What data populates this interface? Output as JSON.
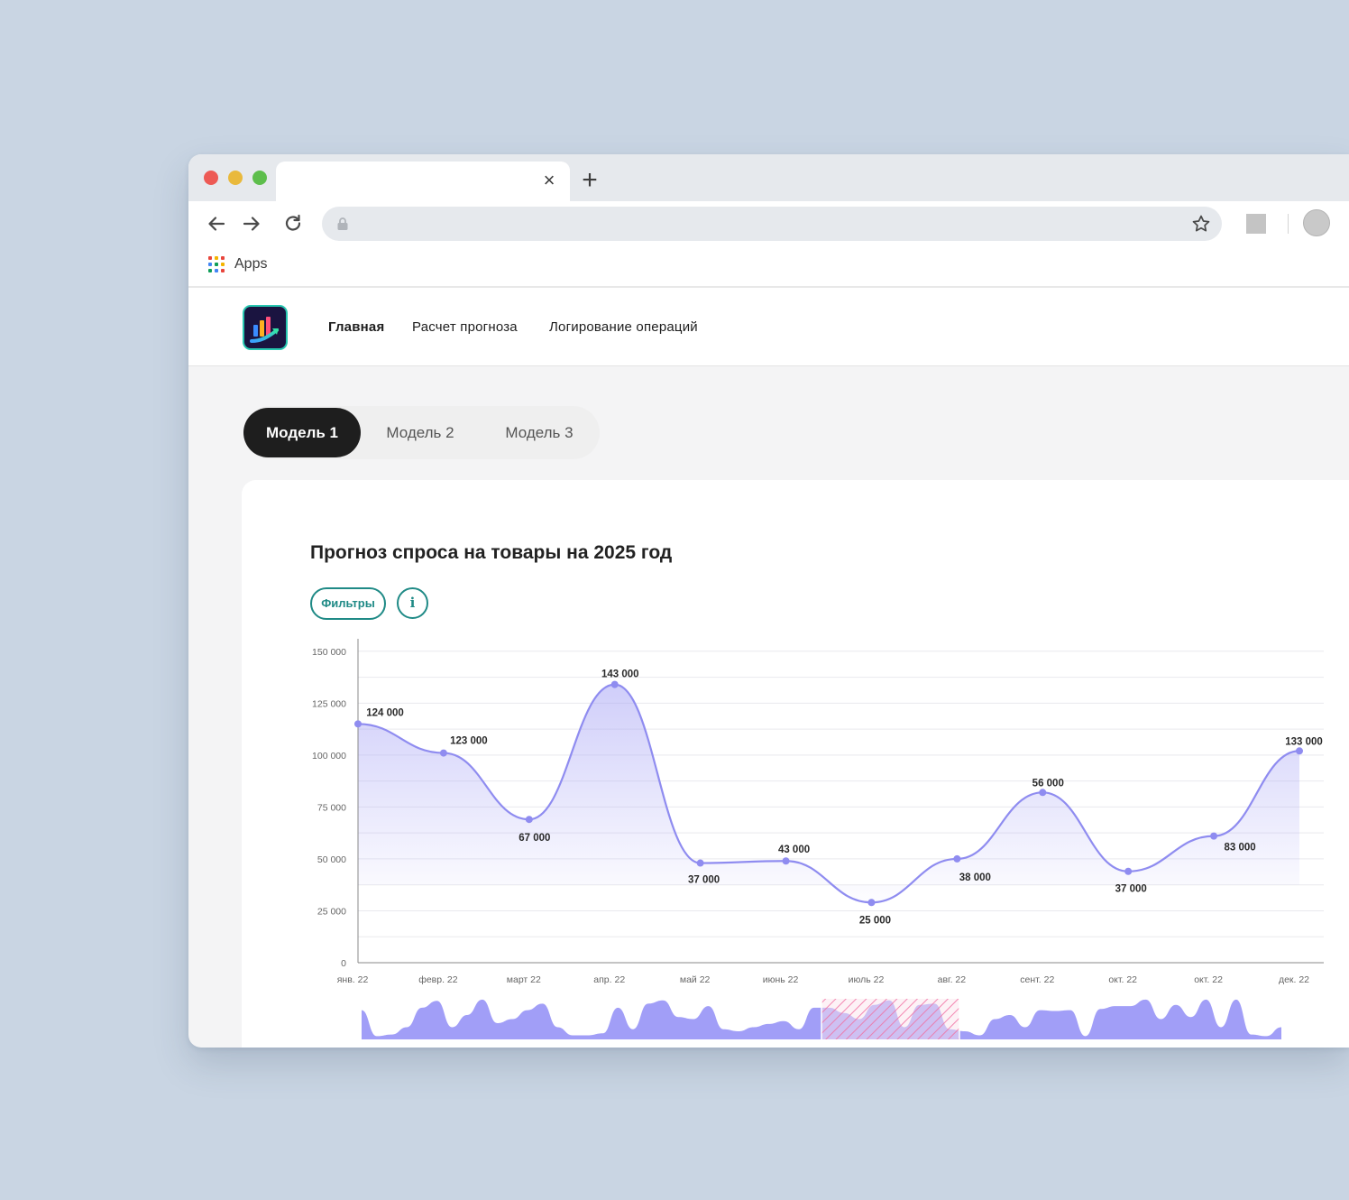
{
  "browser": {
    "tab_close_glyph": "×",
    "new_tab_glyph": "+",
    "bookmarks": {
      "apps_label": "Apps"
    }
  },
  "site": {
    "nav": [
      {
        "label": "Главная",
        "active": true
      },
      {
        "label": "Расчет прогноза",
        "active": false
      },
      {
        "label": "Логирование операций",
        "active": false
      }
    ]
  },
  "model_tabs": [
    {
      "label": "Модель 1",
      "active": true
    },
    {
      "label": "Модель 2",
      "active": false
    },
    {
      "label": "Модель 3",
      "active": false
    }
  ],
  "card": {
    "title": "Прогноз спроса на товары на 2025 год",
    "filters_label": "Фильтры",
    "info_label": "i"
  },
  "colors": {
    "accent": "#1f8a86",
    "line": "#8f8cf0",
    "area": "#a9a6f5",
    "dark": "#1e1e1e"
  },
  "chart_data": {
    "type": "area",
    "x": [
      "янв. 22",
      "февр. 22",
      "март 22",
      "апр. 22",
      "май 22",
      "июнь 22",
      "июль 22",
      "авг. 22",
      "сент. 22",
      "окт. 22",
      "окт. 22",
      "дек. 22"
    ],
    "values": [
      115000,
      101000,
      69000,
      134000,
      48000,
      49000,
      29000,
      50000,
      82000,
      44000,
      61000,
      102000
    ],
    "data_labels": [
      "124 000",
      "123 000",
      "67 000",
      "143 000",
      "37 000",
      "43 000",
      "25 000",
      "38 000",
      "56 000",
      "37 000",
      "83 000",
      "133 000"
    ],
    "y_ticks": [
      "0",
      "25 000",
      "50 000",
      "75 000",
      "100 000",
      "125 000",
      "150 000"
    ],
    "ylim": [
      0,
      156000
    ],
    "grid": true,
    "navigator": {
      "type": "area",
      "values": [
        0.72,
        0.08,
        0.12,
        0.3,
        0.78,
        0.95,
        0.3,
        0.6,
        0.98,
        0.4,
        0.5,
        0.72,
        0.88,
        0.3,
        0.1,
        0.1,
        0.15,
        0.78,
        0.25,
        0.88,
        0.96,
        0.55,
        0.5,
        0.82,
        0.25,
        0.2,
        0.3,
        0.38,
        0.45,
        0.25,
        0.78,
        0.78,
        0.65,
        0.5,
        0.85,
        0.96,
        0.3,
        0.85,
        0.88,
        0.25,
        0.2,
        0.1,
        0.5,
        0.6,
        0.3,
        0.72,
        0.7,
        0.72,
        0.08,
        0.75,
        0.82,
        0.82,
        0.98,
        0.5,
        0.85,
        0.55,
        0.98,
        0.3,
        0.98,
        0.12,
        0.08,
        0.3
      ],
      "selection": [
        0.5,
        0.65
      ]
    }
  }
}
